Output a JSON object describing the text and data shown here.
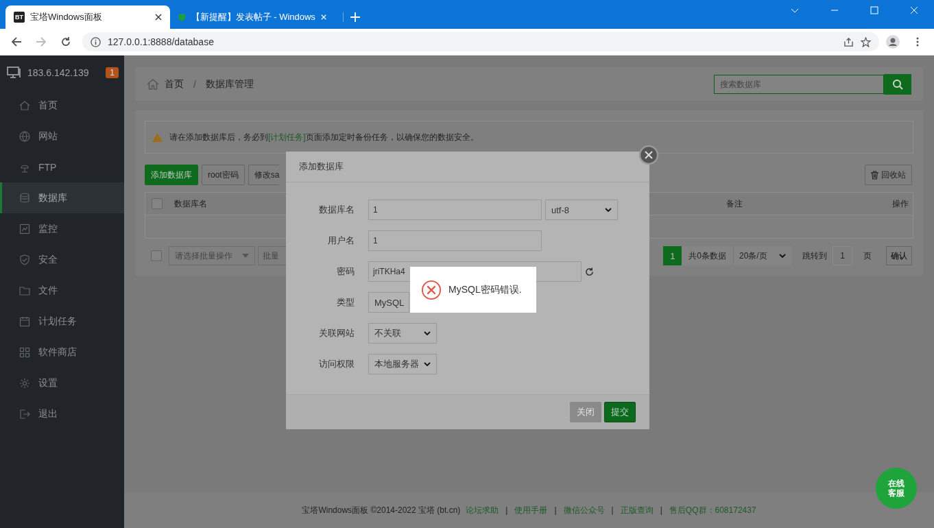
{
  "browser": {
    "tabs": [
      {
        "title": "宝塔Windows面板",
        "icon_text": "BT",
        "selected": true
      },
      {
        "title": "【新提醒】发表帖子 - Windows",
        "selected": false
      }
    ],
    "url": "127.0.0.1:8888/database"
  },
  "sidebar": {
    "server": "183.6.142.139",
    "badge": "1",
    "items": [
      {
        "label": "首页",
        "selected": false
      },
      {
        "label": "网站",
        "selected": false
      },
      {
        "label": "FTP",
        "selected": false
      },
      {
        "label": "数据库",
        "selected": true
      },
      {
        "label": "监控",
        "selected": false
      },
      {
        "label": "安全",
        "selected": false
      },
      {
        "label": "文件",
        "selected": false
      },
      {
        "label": "计划任务",
        "selected": false
      },
      {
        "label": "软件商店",
        "selected": false
      },
      {
        "label": "设置",
        "selected": false
      },
      {
        "label": "退出",
        "selected": false
      }
    ]
  },
  "breadcrumb": [
    "首页",
    "数据库管理"
  ],
  "breadcrumb_separator": "/",
  "search": {
    "placeholder": "搜索数据库"
  },
  "notice": {
    "before": "请在添加数据库后，务必到",
    "link": "[计划任务]",
    "after": "页面添加定时备份任务，以确保您的数据安全。"
  },
  "toolbar": {
    "buttons": [
      {
        "label": "添加数据库",
        "kind": "primary"
      },
      {
        "label": "root密码",
        "kind": "default"
      },
      {
        "label": "修改sa",
        "kind": "default"
      }
    ],
    "recycle": "回收站"
  },
  "table": {
    "select_all_checked": false,
    "columns": [
      "数据库名",
      "备注",
      "操作"
    ]
  },
  "batch": {
    "checked": false,
    "placeholder": "请选择批量操作",
    "button": "批量"
  },
  "pagination": {
    "current": "1",
    "total": "共0条数据",
    "per_page": "20条/页",
    "jump_label": "跳转到",
    "jump_value": "1",
    "unit": "页",
    "confirm": "确认"
  },
  "modal": {
    "title": "添加数据库",
    "fields": [
      {
        "label": "数据库名",
        "kind": "input",
        "value": "1",
        "select": "utf-8"
      },
      {
        "label": "用户名",
        "kind": "input",
        "value": "1"
      },
      {
        "label": "密码",
        "kind": "password",
        "value": "jriTKHa4"
      },
      {
        "label": "类型",
        "kind": "select",
        "value": "MySQL"
      },
      {
        "label": "关联网站",
        "kind": "select",
        "value": "不关联"
      },
      {
        "label": "访问权限",
        "kind": "select",
        "value": "本地服务器"
      }
    ],
    "buttons": [
      {
        "label": "关闭",
        "disabled": true
      },
      {
        "label": "提交",
        "disabled": false
      }
    ]
  },
  "toast": {
    "message": "MySQL密码错误."
  },
  "footer": {
    "separator": "|",
    "copyright": "宝塔Windows面板 ©2014-2022 宝塔 (bt.cn)",
    "links": [
      "论坛求助",
      "使用手册",
      "微信公众号",
      "正版查询",
      "售后QQ群：608172437"
    ]
  },
  "chat_button": "在线客服"
}
